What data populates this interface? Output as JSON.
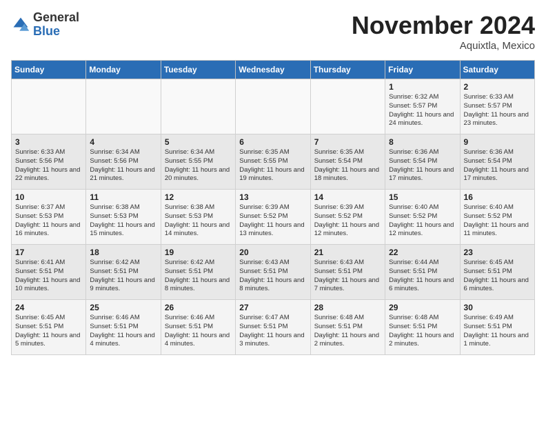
{
  "logo": {
    "general": "General",
    "blue": "Blue"
  },
  "header": {
    "month": "November 2024",
    "location": "Aquixtla, Mexico"
  },
  "weekdays": [
    "Sunday",
    "Monday",
    "Tuesday",
    "Wednesday",
    "Thursday",
    "Friday",
    "Saturday"
  ],
  "weeks": [
    [
      {
        "day": "",
        "info": ""
      },
      {
        "day": "",
        "info": ""
      },
      {
        "day": "",
        "info": ""
      },
      {
        "day": "",
        "info": ""
      },
      {
        "day": "",
        "info": ""
      },
      {
        "day": "1",
        "info": "Sunrise: 6:32 AM\nSunset: 5:57 PM\nDaylight: 11 hours and 24 minutes."
      },
      {
        "day": "2",
        "info": "Sunrise: 6:33 AM\nSunset: 5:57 PM\nDaylight: 11 hours and 23 minutes."
      }
    ],
    [
      {
        "day": "3",
        "info": "Sunrise: 6:33 AM\nSunset: 5:56 PM\nDaylight: 11 hours and 22 minutes."
      },
      {
        "day": "4",
        "info": "Sunrise: 6:34 AM\nSunset: 5:56 PM\nDaylight: 11 hours and 21 minutes."
      },
      {
        "day": "5",
        "info": "Sunrise: 6:34 AM\nSunset: 5:55 PM\nDaylight: 11 hours and 20 minutes."
      },
      {
        "day": "6",
        "info": "Sunrise: 6:35 AM\nSunset: 5:55 PM\nDaylight: 11 hours and 19 minutes."
      },
      {
        "day": "7",
        "info": "Sunrise: 6:35 AM\nSunset: 5:54 PM\nDaylight: 11 hours and 18 minutes."
      },
      {
        "day": "8",
        "info": "Sunrise: 6:36 AM\nSunset: 5:54 PM\nDaylight: 11 hours and 17 minutes."
      },
      {
        "day": "9",
        "info": "Sunrise: 6:36 AM\nSunset: 5:54 PM\nDaylight: 11 hours and 17 minutes."
      }
    ],
    [
      {
        "day": "10",
        "info": "Sunrise: 6:37 AM\nSunset: 5:53 PM\nDaylight: 11 hours and 16 minutes."
      },
      {
        "day": "11",
        "info": "Sunrise: 6:38 AM\nSunset: 5:53 PM\nDaylight: 11 hours and 15 minutes."
      },
      {
        "day": "12",
        "info": "Sunrise: 6:38 AM\nSunset: 5:53 PM\nDaylight: 11 hours and 14 minutes."
      },
      {
        "day": "13",
        "info": "Sunrise: 6:39 AM\nSunset: 5:52 PM\nDaylight: 11 hours and 13 minutes."
      },
      {
        "day": "14",
        "info": "Sunrise: 6:39 AM\nSunset: 5:52 PM\nDaylight: 11 hours and 12 minutes."
      },
      {
        "day": "15",
        "info": "Sunrise: 6:40 AM\nSunset: 5:52 PM\nDaylight: 11 hours and 12 minutes."
      },
      {
        "day": "16",
        "info": "Sunrise: 6:40 AM\nSunset: 5:52 PM\nDaylight: 11 hours and 11 minutes."
      }
    ],
    [
      {
        "day": "17",
        "info": "Sunrise: 6:41 AM\nSunset: 5:51 PM\nDaylight: 11 hours and 10 minutes."
      },
      {
        "day": "18",
        "info": "Sunrise: 6:42 AM\nSunset: 5:51 PM\nDaylight: 11 hours and 9 minutes."
      },
      {
        "day": "19",
        "info": "Sunrise: 6:42 AM\nSunset: 5:51 PM\nDaylight: 11 hours and 8 minutes."
      },
      {
        "day": "20",
        "info": "Sunrise: 6:43 AM\nSunset: 5:51 PM\nDaylight: 11 hours and 8 minutes."
      },
      {
        "day": "21",
        "info": "Sunrise: 6:43 AM\nSunset: 5:51 PM\nDaylight: 11 hours and 7 minutes."
      },
      {
        "day": "22",
        "info": "Sunrise: 6:44 AM\nSunset: 5:51 PM\nDaylight: 11 hours and 6 minutes."
      },
      {
        "day": "23",
        "info": "Sunrise: 6:45 AM\nSunset: 5:51 PM\nDaylight: 11 hours and 6 minutes."
      }
    ],
    [
      {
        "day": "24",
        "info": "Sunrise: 6:45 AM\nSunset: 5:51 PM\nDaylight: 11 hours and 5 minutes."
      },
      {
        "day": "25",
        "info": "Sunrise: 6:46 AM\nSunset: 5:51 PM\nDaylight: 11 hours and 4 minutes."
      },
      {
        "day": "26",
        "info": "Sunrise: 6:46 AM\nSunset: 5:51 PM\nDaylight: 11 hours and 4 minutes."
      },
      {
        "day": "27",
        "info": "Sunrise: 6:47 AM\nSunset: 5:51 PM\nDaylight: 11 hours and 3 minutes."
      },
      {
        "day": "28",
        "info": "Sunrise: 6:48 AM\nSunset: 5:51 PM\nDaylight: 11 hours and 2 minutes."
      },
      {
        "day": "29",
        "info": "Sunrise: 6:48 AM\nSunset: 5:51 PM\nDaylight: 11 hours and 2 minutes."
      },
      {
        "day": "30",
        "info": "Sunrise: 6:49 AM\nSunset: 5:51 PM\nDaylight: 11 hours and 1 minute."
      }
    ]
  ]
}
